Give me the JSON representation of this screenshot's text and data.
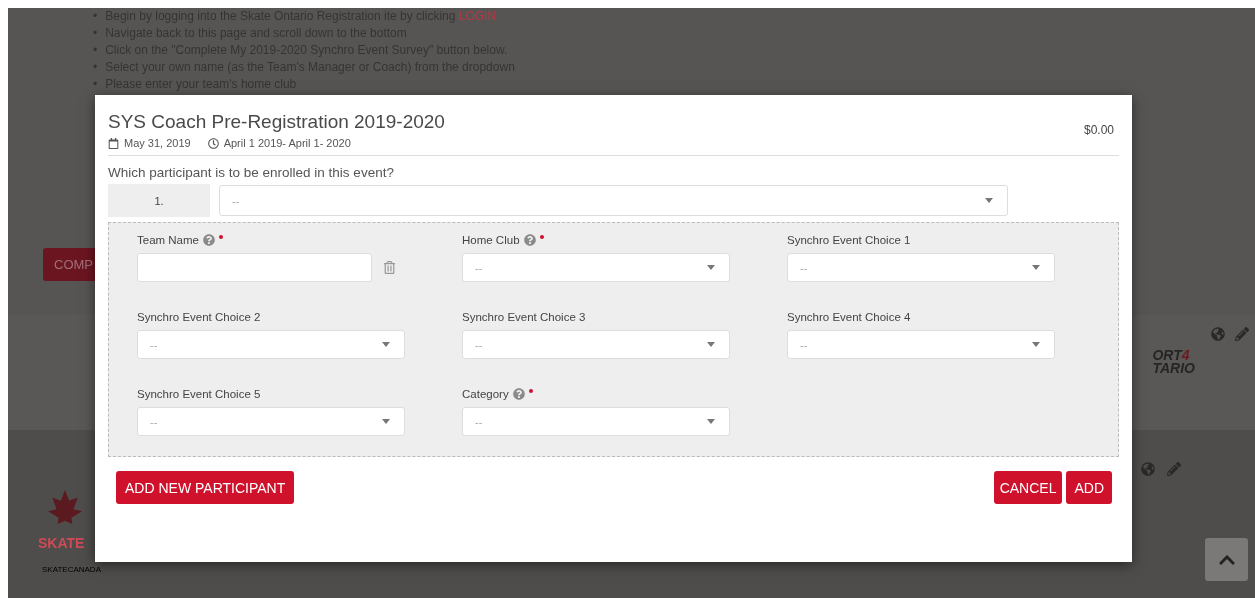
{
  "background": {
    "instructions": [
      {
        "marker": "•",
        "text": "Begin by logging into the Skate Ontario Registration ite by clicking",
        "link": "LOGIN"
      },
      {
        "marker": "•",
        "text": "Navigate back to this page and scroll down to the bottom"
      },
      {
        "marker": "•",
        "text": "Click on the \"Complete My 2019-2020 Synchro Event Survey\" button below."
      },
      {
        "marker": "•",
        "text": "Select your own name (as the Team's Manager or Coach) from the dropdown"
      },
      {
        "marker": "•",
        "text": "Please enter your team's home club"
      }
    ],
    "survey_button": "COMP",
    "sport_logo": {
      "lines": [
        {
          "text": "ORT",
          "accent": "4"
        },
        {
          "text": "TARIO"
        }
      ]
    },
    "skate_logo": {
      "name": "SKATE",
      "subtitle": "SKATECANADA"
    }
  },
  "modal": {
    "title": "SYS Coach Pre-Registration 2019-2020",
    "price": "$0.00",
    "date": "May 31, 2019",
    "period": "April 1 2019- April 1- 2020",
    "question": "Which participant is to be enrolled in this event?",
    "participant": {
      "number": "1.",
      "value": "--"
    },
    "fields": [
      {
        "label": "Team Name",
        "help": true,
        "required": true,
        "kind": "text"
      },
      {
        "label": "Home Club",
        "help": true,
        "required": true,
        "kind": "select",
        "value": "--"
      },
      {
        "label": "Synchro Event Choice 1",
        "help": false,
        "required": false,
        "kind": "select",
        "value": "--"
      },
      {
        "label": "Synchro Event Choice 2",
        "help": false,
        "required": false,
        "kind": "select",
        "value": "--"
      },
      {
        "label": "Synchro Event Choice 3",
        "help": false,
        "required": false,
        "kind": "select",
        "value": "--"
      },
      {
        "label": "Synchro Event Choice 4",
        "help": false,
        "required": false,
        "kind": "select",
        "value": "--"
      },
      {
        "label": "Synchro Event Choice 5",
        "help": false,
        "required": false,
        "kind": "select",
        "value": "--"
      },
      {
        "label": "Category",
        "help": true,
        "required": true,
        "kind": "select",
        "value": "--"
      }
    ],
    "add_participant": "ADD NEW PARTICIPANT",
    "cancel": "CANCEL",
    "add": "ADD"
  }
}
